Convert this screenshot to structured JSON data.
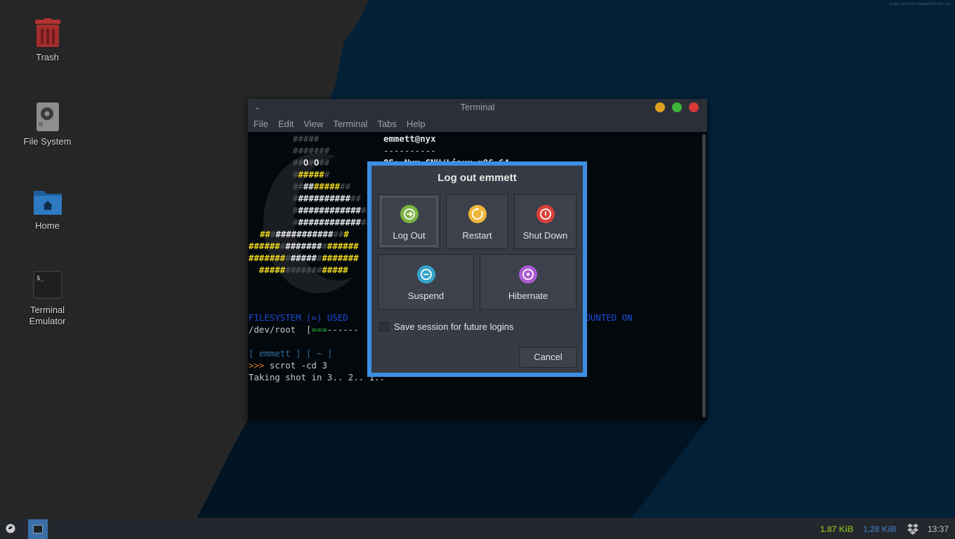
{
  "credit": "Image hosted by WallpaperHeader.com",
  "desktop": {
    "icons": [
      {
        "label": "Trash"
      },
      {
        "label": "File System"
      },
      {
        "label": "Home"
      },
      {
        "label": "Terminal Emulator",
        "glyph": "$_"
      }
    ]
  },
  "terminal": {
    "title": "Terminal",
    "toggle": "⌄",
    "menu": [
      "File",
      "Edit",
      "View",
      "Terminal",
      "Tabs",
      "Help"
    ],
    "user_host": "emmett@nyx",
    "separator": "----------",
    "os_line": "OS: Nyx GNU/Linux x86_64",
    "fs_header_left": "FILESYSTEM (=) USED",
    "fs_header_right": "MOUNTED ON",
    "fs_row": "/dev/root",
    "bar_fill": "===",
    "bar_rest": "------",
    "prompt_user": "[ emmett ] [ ~ ]",
    "prompt_arrow": ">>>",
    "command": "scrot -cd 3",
    "output": "Taking shot in 3.. 2.. 1.."
  },
  "dialog": {
    "title": "Log out emmett",
    "actions": [
      {
        "label": "Log Out",
        "color": "#7cb342",
        "icon": "logout-icon"
      },
      {
        "label": "Restart",
        "color": "#f0b63a",
        "icon": "restart-icon"
      },
      {
        "label": "Shut Down",
        "color": "#d9413a",
        "icon": "power-icon"
      },
      {
        "label": "Suspend",
        "color": "#36a3c9",
        "icon": "suspend-icon"
      },
      {
        "label": "Hibernate",
        "color": "#ab5ad0",
        "icon": "hibernate-icon"
      }
    ],
    "save_session": {
      "label": "Save session for future logins",
      "checked": false
    },
    "cancel": "Cancel"
  },
  "taskbar": {
    "net_up": "1.87 KiB",
    "net_down": "1.28 KiB",
    "clock": "13:37"
  }
}
